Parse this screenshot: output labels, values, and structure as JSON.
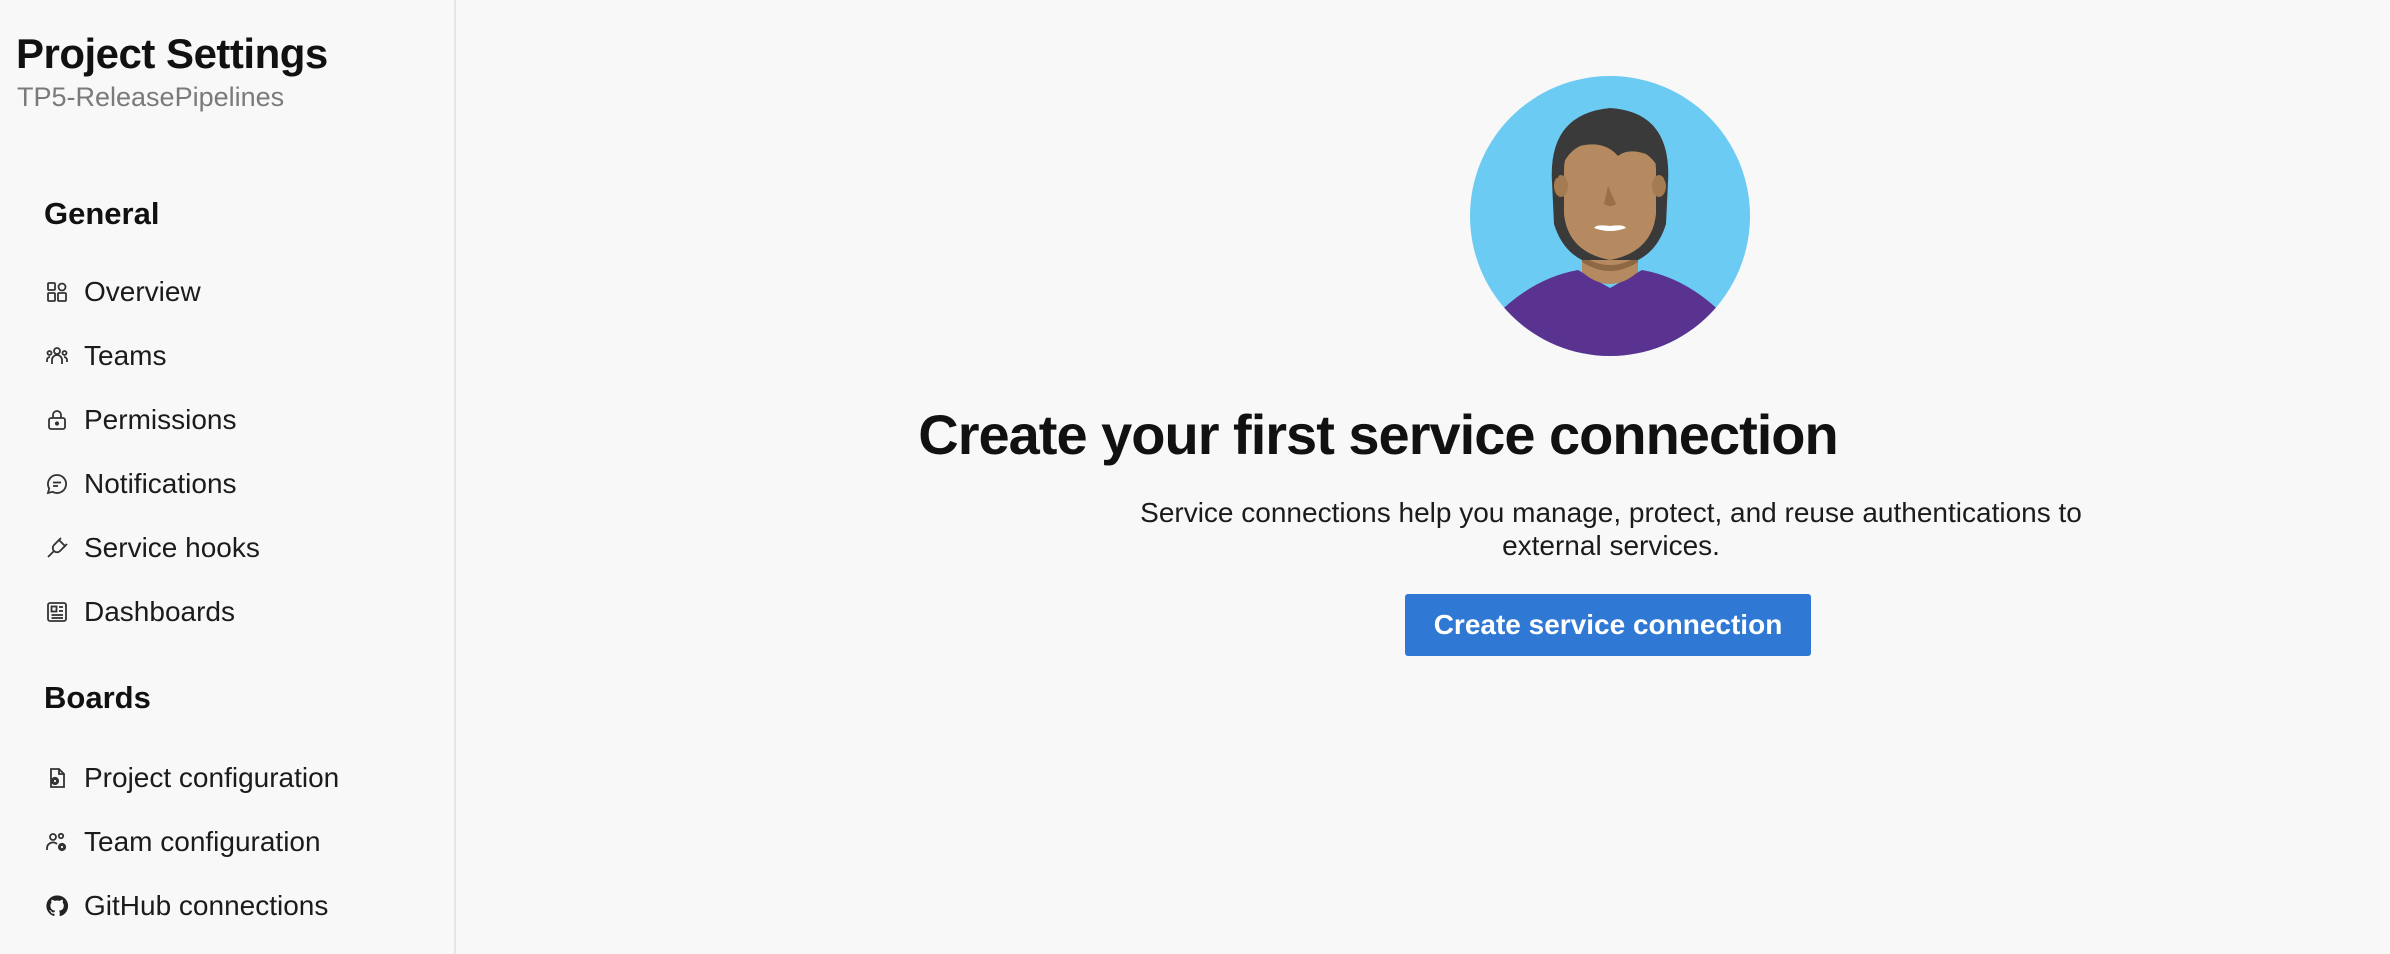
{
  "sidebar": {
    "title": "Project Settings",
    "subtitle": "TP5-ReleasePipelines",
    "sections": [
      {
        "heading": "General",
        "items": [
          {
            "label": "Overview",
            "icon": "overview-icon"
          },
          {
            "label": "Teams",
            "icon": "teams-icon"
          },
          {
            "label": "Permissions",
            "icon": "lock-icon"
          },
          {
            "label": "Notifications",
            "icon": "chat-bubble-icon"
          },
          {
            "label": "Service hooks",
            "icon": "plug-icon"
          },
          {
            "label": "Dashboards",
            "icon": "dashboard-icon"
          }
        ]
      },
      {
        "heading": "Boards",
        "items": [
          {
            "label": "Project configuration",
            "icon": "document-gear-icon"
          },
          {
            "label": "Team configuration",
            "icon": "people-gear-icon"
          },
          {
            "label": "GitHub connections",
            "icon": "github-icon"
          }
        ]
      }
    ]
  },
  "main": {
    "avatar_icon": "person-avatar-illustration",
    "title": "Create your first service connection",
    "description": "Service connections help you manage, protect, and reuse authentications to external services.",
    "button_label": "Create service connection"
  },
  "colors": {
    "primary_button": "#2f79d4",
    "avatar_bg": "#6ccbf2",
    "shirt": "#5a3290",
    "skin": "#b58a60",
    "hair": "#3a3a3a"
  }
}
